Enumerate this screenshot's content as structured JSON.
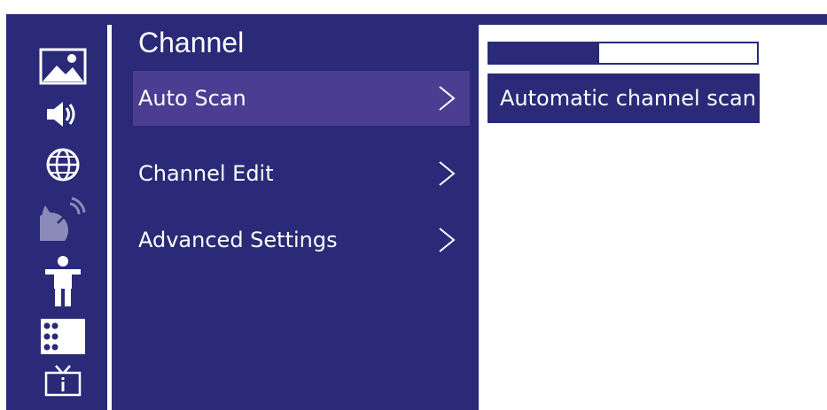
{
  "colors": {
    "panel": "#2a2a78",
    "selected": "#4a3d92",
    "text": "#ffffff",
    "icon_active": "#ffffff",
    "icon_inactive": "#8c8ab9"
  },
  "rail": {
    "icons": [
      {
        "name": "picture-icon",
        "active": true
      },
      {
        "name": "sound-icon",
        "active": true
      },
      {
        "name": "network-globe-icon",
        "active": true
      },
      {
        "name": "satellite-dish-icon",
        "active": false
      },
      {
        "name": "accessibility-person-icon",
        "active": true
      },
      {
        "name": "apps-grid-icon",
        "active": true
      },
      {
        "name": "tv-info-icon",
        "active": true
      }
    ]
  },
  "menu": {
    "title": "Channel",
    "items": [
      {
        "label": "Auto Scan",
        "selected": true,
        "chevron": "chevron-right-icon"
      },
      {
        "label": "Channel Edit",
        "selected": false,
        "chevron": "chevron-right-icon"
      },
      {
        "label": "Advanced Settings",
        "selected": false,
        "chevron": "chevron-right-icon"
      }
    ]
  },
  "detail": {
    "progress_fraction": 0.41,
    "description": "Automatic channel scan"
  }
}
